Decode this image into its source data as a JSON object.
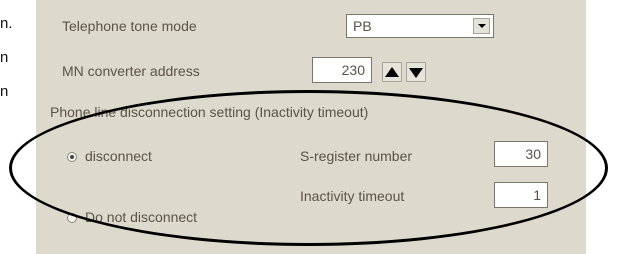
{
  "side_text": [
    "n.",
    "n",
    "n"
  ],
  "form": {
    "tone_mode": {
      "label": "Telephone tone mode",
      "value": "PB"
    },
    "mn_address": {
      "label": "MN converter address",
      "value": "230"
    },
    "group_title": "Phone line disconnection setting (Inactivity timeout)",
    "disconnect": {
      "label": "disconnect",
      "checked": true
    },
    "do_not_disconnect": {
      "label": "Do not disconnect",
      "checked": false
    },
    "sregister": {
      "label": "S-register number",
      "value": "30"
    },
    "inactivity": {
      "label": "Inactivity timeout",
      "value": "1"
    }
  },
  "colors": {
    "panel_bg": "#ddd9cd",
    "label_text": "#5a5346",
    "annotation": "#000000"
  }
}
